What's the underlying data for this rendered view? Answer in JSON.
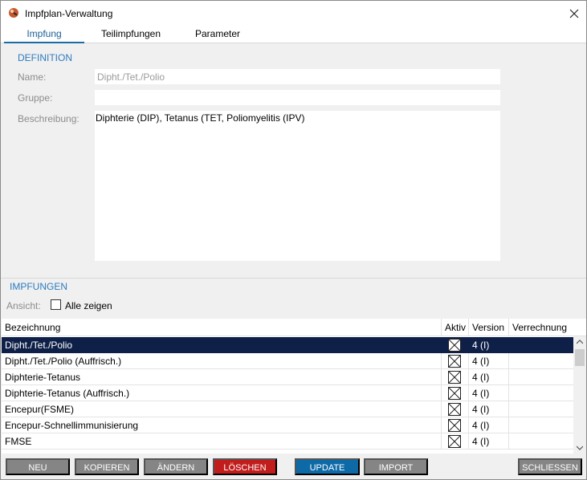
{
  "window": {
    "title": "Impfplan-Verwaltung"
  },
  "tabs": [
    {
      "label": "Impfung"
    },
    {
      "label": "Teilimpfungen"
    },
    {
      "label": "Parameter"
    }
  ],
  "definition": {
    "section_title": "DEFINITION",
    "name_label": "Name:",
    "name_value": "Dipht./Tet./Polio",
    "gruppe_label": "Gruppe:",
    "gruppe_value": "",
    "beschreibung_label": "Beschreibung:",
    "beschreibung_value": "Diphterie (DIP), Tetanus (TET, Poliomyelitis (IPV)"
  },
  "impfungen": {
    "section_title": "IMPFUNGEN",
    "ansicht_label": "Ansicht:",
    "alle_zeigen_label": "Alle zeigen",
    "alle_zeigen_checked": false,
    "columns": [
      "Bezeichnung",
      "Aktiv",
      "Version",
      "Verrechnung"
    ],
    "rows": [
      {
        "bezeichnung": "Dipht./Tet./Polio",
        "version": "4 (I)",
        "verrechnung": "",
        "selected": true
      },
      {
        "bezeichnung": "Dipht./Tet./Polio (Auffrisch.)",
        "version": "4 (I)",
        "verrechnung": ""
      },
      {
        "bezeichnung": "Diphterie-Tetanus",
        "version": "4 (I)",
        "verrechnung": ""
      },
      {
        "bezeichnung": "Diphterie-Tetanus (Auffrisch.)",
        "version": "4 (I)",
        "verrechnung": ""
      },
      {
        "bezeichnung": "Encepur(FSME)",
        "version": "4 (I)",
        "verrechnung": ""
      },
      {
        "bezeichnung": "Encepur-Schnellimmunisierung",
        "version": "4 (I)",
        "verrechnung": ""
      },
      {
        "bezeichnung": "FMSE",
        "version": "4 (I)",
        "verrechnung": ""
      }
    ]
  },
  "buttons": {
    "neu": "NEU",
    "kopieren": "KOPIEREN",
    "aendern": "ÄNDERN",
    "loeschen": "LÖSCHEN",
    "update": "UPDATE",
    "import": "IMPORT",
    "schliessen": "SCHLIESSEN"
  },
  "colors": {
    "accent": "#1b6ba8",
    "selection": "#0e2048",
    "delete": "#c21d1d",
    "update": "#0d6aa7",
    "button_gray": "#858585"
  },
  "icons": {
    "app": "syringe-icon",
    "close": "close-icon",
    "scroll_up": "chevron-up-icon",
    "scroll_down": "chevron-down-icon",
    "aktiv": "checkbox-x-icon"
  }
}
